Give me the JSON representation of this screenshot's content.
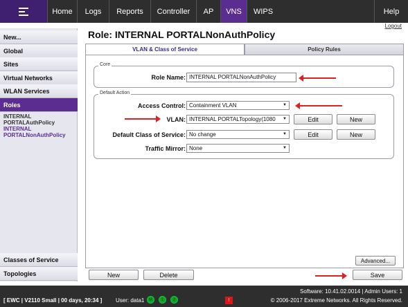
{
  "nav": {
    "items": [
      "Home",
      "Logs",
      "Reports",
      "Controller",
      "AP",
      "VNS",
      "WIPS"
    ],
    "help": "Help",
    "logout": "Logout"
  },
  "sidebar": {
    "items": [
      "New...",
      "Global",
      "Sites",
      "Virtual Networks",
      "WLAN Services",
      "Roles"
    ],
    "sub_items": [
      "INTERNAL",
      "PORTALAuthPolicy",
      "INTERNAL",
      "PORTALNonAuthPolicy"
    ],
    "bottom_items": [
      "Classes of Service",
      "Topologies"
    ]
  },
  "page": {
    "title": "Role: INTERNAL PORTALNonAuthPolicy",
    "tabs": [
      "VLAN & Class of Service",
      "Policy Rules"
    ]
  },
  "core": {
    "legend": "Core",
    "role_name_label": "Role Name:",
    "role_name_value": "INTERNAL PORTALNonAuthPolicy"
  },
  "default_action": {
    "legend": "Default Action",
    "access_control_label": "Access Control:",
    "access_control_value": "Containment VLAN",
    "vlan_label": "VLAN:",
    "vlan_value": "INTERNAL PORTALTopology(1080",
    "cos_label": "Default Class of Service:",
    "cos_value": "No change",
    "mirror_label": "Traffic Mirror:",
    "mirror_value": "None",
    "edit_label": "Edit",
    "new_label": "New"
  },
  "buttons": {
    "advanced": "Advanced...",
    "new": "New",
    "delete": "Delete",
    "save": "Save"
  },
  "status": {
    "left": "[ EWC | V2110 Small | 00 days, 20:34 ]",
    "user": "User: data1",
    "indicators": [
      "M",
      "1",
      "2"
    ],
    "alarm": "!",
    "software": "Software: 10.41.02.0014 | Admin Users: 1",
    "copyright": "© 2006-2017  Extreme Networks. All Rights Reserved."
  },
  "colors": {
    "brand_purple": "#5c2d91",
    "bar_dark": "#2e2e2e",
    "arrow_red": "#e02020"
  }
}
